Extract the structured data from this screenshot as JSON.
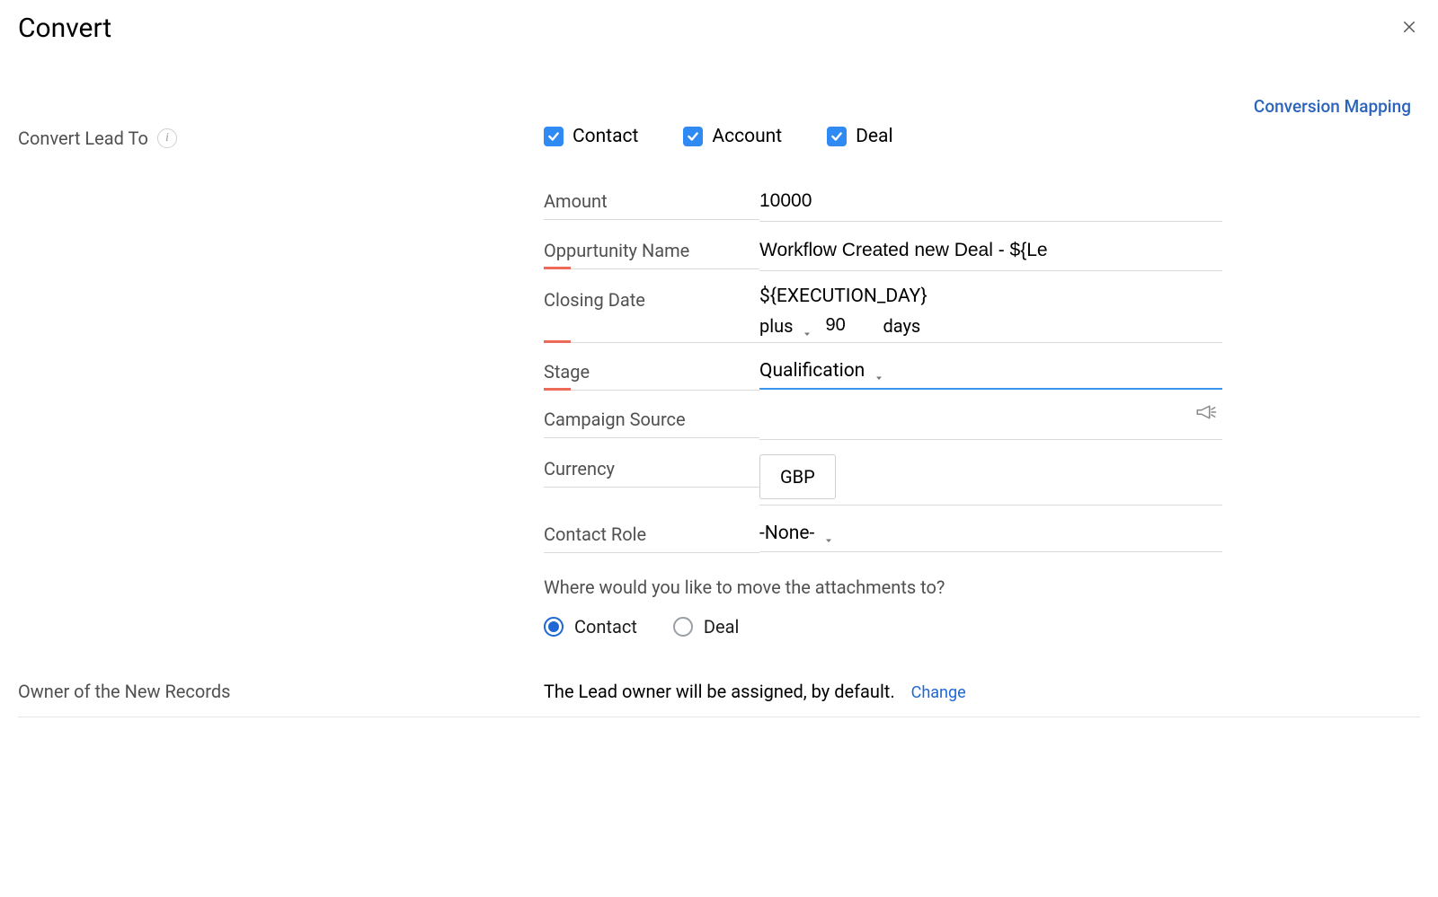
{
  "header": {
    "title": "Convert",
    "mapping_link": "Conversion Mapping"
  },
  "labels": {
    "convert_lead_to": "Convert Lead To",
    "amount": "Amount",
    "opportunity_name": "Oppurtunity Name",
    "closing_date": "Closing Date",
    "stage": "Stage",
    "campaign_source": "Campaign Source",
    "currency": "Currency",
    "contact_role": "Contact Role",
    "attachments_question": "Where would you like to move the attachments to?",
    "owner_label": "Owner of the New Records",
    "owner_text": "The Lead owner will be assigned, by default.",
    "change": "Change",
    "days": "days"
  },
  "checkboxes": {
    "contact": {
      "label": "Contact",
      "checked": true
    },
    "account": {
      "label": "Account",
      "checked": true
    },
    "deal": {
      "label": "Deal",
      "checked": true
    }
  },
  "fields": {
    "amount": "10000",
    "opportunity_name": "Workflow Created new Deal - ${Le",
    "closing_date_expression": "${EXECUTION_DAY}",
    "closing_offset_op": "plus",
    "closing_offset_value": "90",
    "stage": "Qualification",
    "campaign_source": "",
    "currency": "GBP",
    "contact_role": "-None-"
  },
  "radios": {
    "attachments": {
      "contact": {
        "label": "Contact",
        "selected": true
      },
      "deal": {
        "label": "Deal",
        "selected": false
      }
    }
  }
}
